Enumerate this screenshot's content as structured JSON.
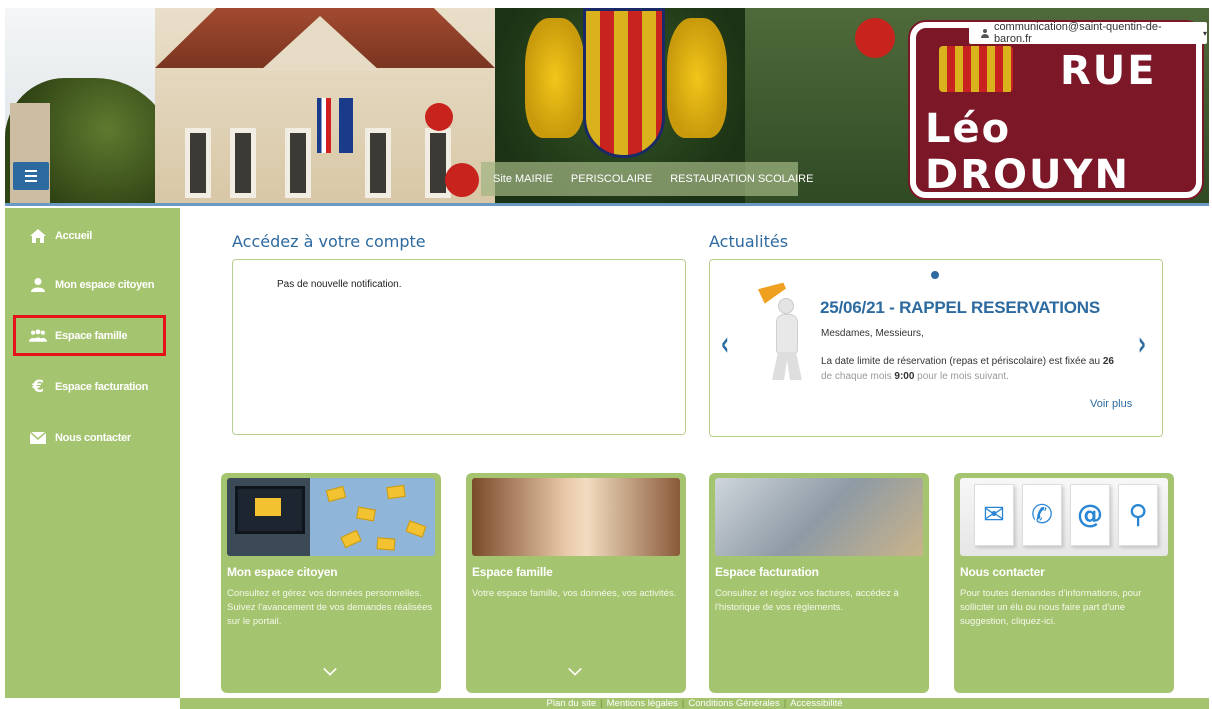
{
  "header": {
    "top_nav": [
      "Site MAIRIE",
      "PERISCOLAIRE",
      "RESTAURATION SCOLAIRE"
    ],
    "user_email": "communication@saint-quentin-de-baron.fr",
    "street_sign": {
      "line1": "RUE",
      "line2": "Léo DROUYN"
    }
  },
  "sidebar": {
    "items": [
      {
        "label": "Accueil",
        "icon": "home-icon"
      },
      {
        "label": "Mon espace citoyen",
        "icon": "user-icon"
      },
      {
        "label": "Espace famille",
        "icon": "family-icon"
      },
      {
        "label": "Espace facturation",
        "icon": "euro-icon"
      },
      {
        "label": "Nous contacter",
        "icon": "envelope-icon"
      }
    ]
  },
  "account": {
    "title": "Accédez à votre compte",
    "notification": "Pas de nouvelle notification."
  },
  "news": {
    "title": "Actualités",
    "headline": "25/06/21 - RAPPEL RESERVATIONS",
    "greeting": "Mesdames, Messieurs,",
    "body_prefix": "La date limite de réservation (repas et périscolaire) est fixée au ",
    "body_bold": "26",
    "line2_prefix": "de chaque mois ",
    "line2_bold": "9:00",
    "line2_suffix": " pour le mois suivant.",
    "more_link": "Voir plus"
  },
  "cards": [
    {
      "title": "Mon espace citoyen",
      "desc": "Consultez et gérez vos données personnelles. Suivez l'avancement de vos demandes réalisées sur le portail."
    },
    {
      "title": "Espace famille",
      "desc": "Votre espace famille, vos données, vos activités."
    },
    {
      "title": "Espace facturation",
      "desc": "Consultez et réglez vos factures, accédez à l'historique de vos règlements."
    },
    {
      "title": "Nous contacter",
      "desc": "Pour toutes demandes d'informations, pour solliciter un élu ou nous faire part d'une suggestion, cliquez-ici."
    }
  ],
  "contact_tiles": [
    "✉",
    "✆",
    "@",
    "⚲"
  ],
  "footer": {
    "links": [
      "Plan du site",
      "Mentions légales",
      "Conditions Générales",
      "Accessibilité"
    ],
    "separator": "|"
  },
  "colors": {
    "sidebar_green": "#a5c46f",
    "accent_blue": "#2c6aa0",
    "highlight_red": "#e5121a"
  }
}
